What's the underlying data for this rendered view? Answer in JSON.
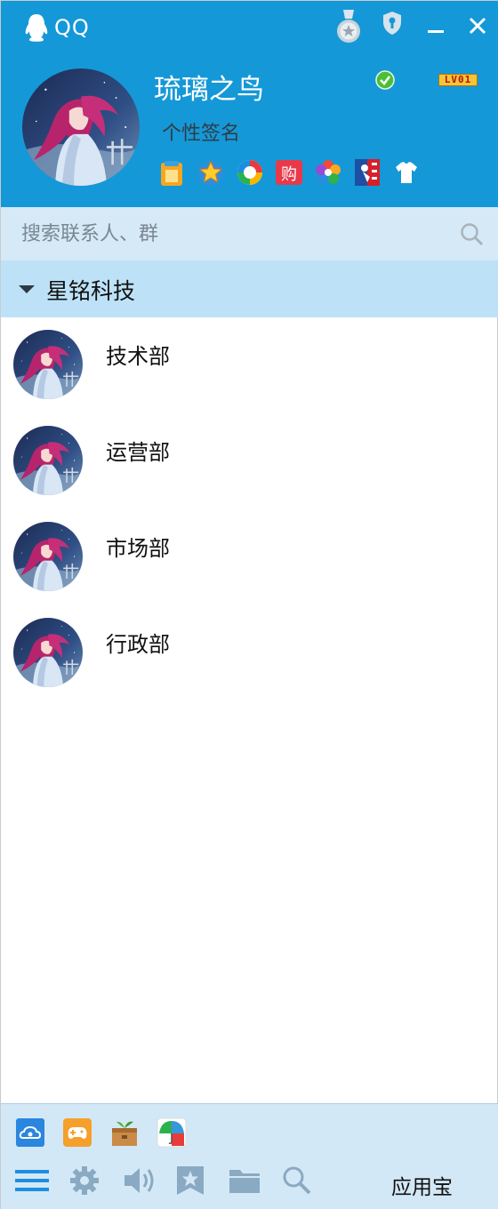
{
  "titlebar": {
    "app_name": "QQ"
  },
  "profile": {
    "nickname": "琉璃之鸟",
    "signature": "个性签名",
    "level": "LV01",
    "status": "online"
  },
  "search": {
    "placeholder": "搜索联系人、群"
  },
  "group": {
    "name": "星铭科技",
    "expanded": true,
    "contacts": [
      {
        "name": "技术部"
      },
      {
        "name": "运营部"
      },
      {
        "name": "市场部"
      },
      {
        "name": "行政部"
      }
    ]
  },
  "bottom": {
    "app_store_label": "应用宝"
  },
  "icons": {
    "top": [
      "medal-icon",
      "shield-icon",
      "minimize-icon",
      "close-icon"
    ],
    "profile_apps": [
      "wallet-icon",
      "star-badge-icon",
      "qzone-icon",
      "shopping-icon",
      "photo-icon",
      "nba-icon",
      "tshirt-icon"
    ],
    "bottom_apps": [
      "cloud-drive-icon",
      "game-icon",
      "box-icon",
      "umbrella-icon"
    ],
    "bottom_tools": [
      "menu-icon",
      "settings-icon",
      "volume-icon",
      "favorites-icon",
      "folder-icon",
      "search-icon"
    ]
  },
  "colors": {
    "header_bg": "#1598d7",
    "search_bg": "#d5e9f6",
    "group_bg": "#bde2f8",
    "bottom_bg": "#d3e8f6"
  }
}
